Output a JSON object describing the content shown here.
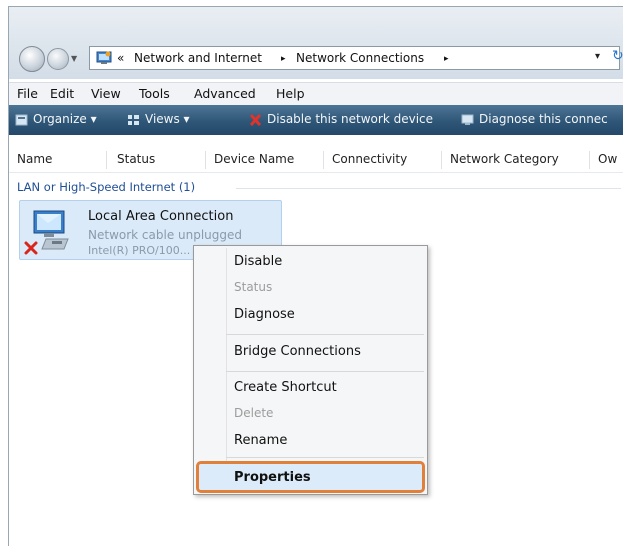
{
  "address_bar": {
    "chevrons": "«",
    "crumbs": [
      "Network and Internet",
      "Network Connections"
    ],
    "separator": "▸",
    "dropdown_icon": "▾",
    "refresh_icon": "↻"
  },
  "menu_bar": [
    "File",
    "Edit",
    "View",
    "Tools",
    "Advanced",
    "Help"
  ],
  "command_bar": {
    "organize": "Organize ▾",
    "views": "Views ▾",
    "disable": "Disable this network device",
    "diagnose": "Diagnose this connec"
  },
  "columns": [
    "Name",
    "Status",
    "Device Name",
    "Connectivity",
    "Network Category",
    "Ow"
  ],
  "group": {
    "header": "LAN or High-Speed Internet (1)"
  },
  "connection": {
    "name": "Local Area Connection",
    "status": "Network cable unplugged",
    "device": "Intel(R) PRO/100..."
  },
  "context_menu": {
    "disable": "Disable",
    "status": "Status",
    "diagnose": "Diagnose",
    "bridge": "Bridge Connections",
    "shortcut": "Create Shortcut",
    "delete": "Delete",
    "rename": "Rename",
    "properties": "Properties"
  },
  "colors": {
    "highlight_border": "#e0803a",
    "command_bar": "#2f5677",
    "selection": "#dbeaf9"
  }
}
